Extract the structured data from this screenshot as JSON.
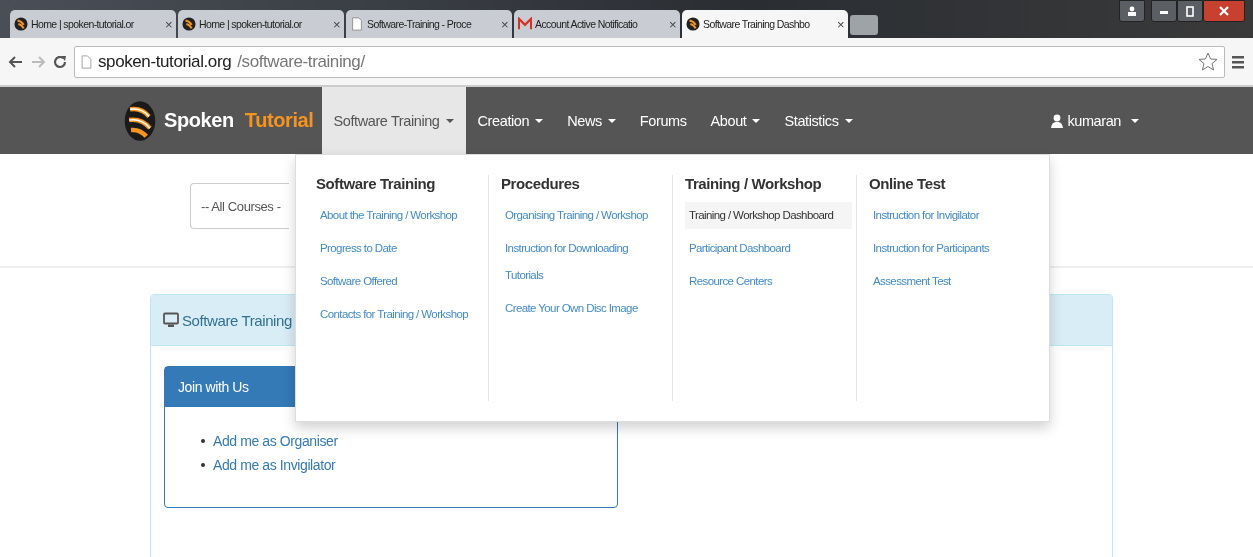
{
  "browser_tabs": [
    {
      "title": "Home | spoken-tutorial.or",
      "kind": "logo",
      "selected": false
    },
    {
      "title": "Home | spoken-tutorial.or",
      "kind": "logo",
      "selected": false
    },
    {
      "title": "Software-Training - Proce",
      "kind": "page",
      "selected": false
    },
    {
      "title": "Account Active Notificatio",
      "kind": "mail",
      "selected": false
    },
    {
      "title": "Software Training Dashbo",
      "kind": "logo",
      "selected": true
    }
  ],
  "tab_close": "×",
  "address_bar": {
    "host": "spoken-tutorial.org",
    "path": "/software-training/"
  },
  "navbar": {
    "brand": {
      "first": "Spoken",
      "second": "Tutorial"
    },
    "items": [
      {
        "label": "Software Training",
        "caret": true,
        "selected": true
      },
      {
        "label": "Creation",
        "caret": true,
        "selected": false
      },
      {
        "label": "News",
        "caret": true,
        "selected": false
      },
      {
        "label": "Forums",
        "caret": false,
        "selected": false
      },
      {
        "label": "About",
        "caret": true,
        "selected": false
      },
      {
        "label": "Statistics",
        "caret": true,
        "selected": false
      }
    ],
    "user": {
      "label": "kumaran",
      "caret": true
    }
  },
  "dropdown": {
    "columns": [
      {
        "heading": "Software Training",
        "items": [
          {
            "label": "About the Training / Workshop",
            "highlighted": false
          },
          {
            "label": "Progress to Date",
            "highlighted": false
          },
          {
            "label": "Software Offered",
            "highlighted": false
          },
          {
            "label": "Contacts for Training / Workshop",
            "highlighted": false
          }
        ]
      },
      {
        "heading": "Procedures",
        "items": [
          {
            "label": "Organising Training / Workshop",
            "highlighted": false
          },
          {
            "label": "Instruction for Downloading Tutorials",
            "highlighted": false
          },
          {
            "label": "Create Your Own Disc Image",
            "highlighted": false
          }
        ]
      },
      {
        "heading": "Training / Workshop",
        "items": [
          {
            "label": "Training / Workshop Dashboard",
            "highlighted": true
          },
          {
            "label": "Participant Dashboard",
            "highlighted": false
          },
          {
            "label": "Resource Centers",
            "highlighted": false
          }
        ]
      },
      {
        "heading": "Online Test",
        "items": [
          {
            "label": "Instruction for Invigilator",
            "highlighted": false
          },
          {
            "label": "Instruction for Participants",
            "highlighted": false
          },
          {
            "label": "Assessment Test",
            "highlighted": false
          }
        ]
      }
    ]
  },
  "course_select": {
    "value": "-- All Courses -"
  },
  "panel": {
    "title": "Software Training",
    "card": {
      "title": "Join with Us",
      "links": [
        "Add me as Organiser",
        "Add me as Invigilator"
      ]
    }
  }
}
